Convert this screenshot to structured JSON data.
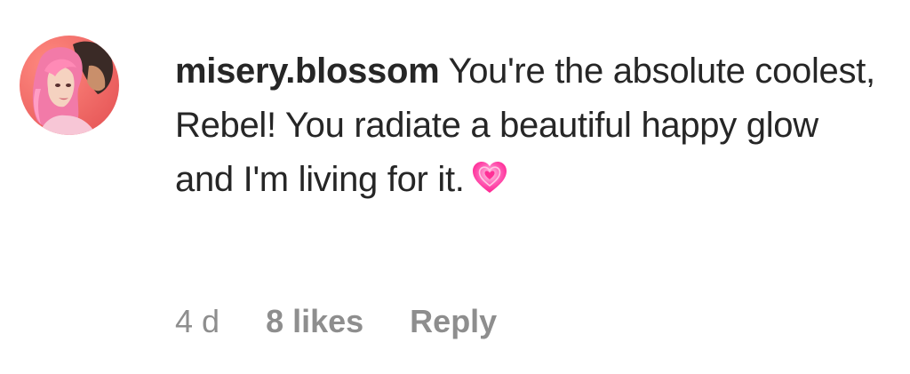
{
  "comment": {
    "username": "misery.blossom",
    "text": " You're the absolute coolest, Rebel! You radiate a beautiful happy glow and I'm living for it.",
    "emoji_icon": "growing-heart-icon",
    "timestamp": "4 d",
    "likes": "8 likes",
    "reply_label": "Reply",
    "colors": {
      "text": "#262626",
      "meta": "#8e8e8e",
      "heart": "#ff3fa0"
    }
  }
}
